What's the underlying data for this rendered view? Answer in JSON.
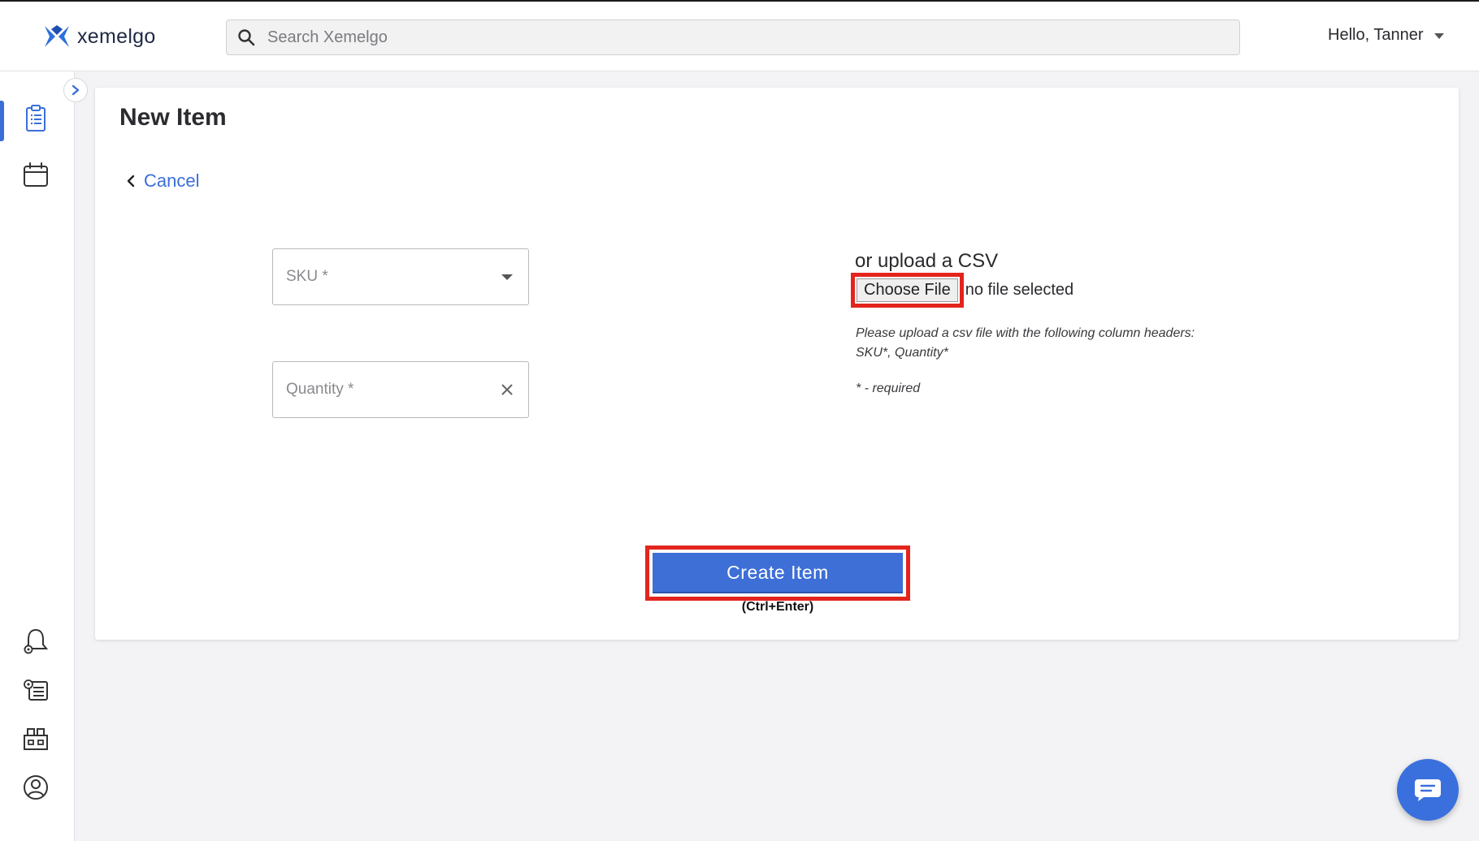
{
  "app": {
    "logo_text": "xemelgo"
  },
  "header": {
    "search": {
      "placeholder": "Search Xemelgo",
      "value": ""
    },
    "user_greeting": "Hello, Tanner"
  },
  "sidebar": {
    "items": [
      {
        "icon": "clipboard-list-icon",
        "active": true
      },
      {
        "icon": "calendar-icon",
        "active": false
      },
      {
        "icon": "bell-gear-icon",
        "active": false
      },
      {
        "icon": "list-gear-icon",
        "active": false
      },
      {
        "icon": "factory-icon",
        "active": false
      },
      {
        "icon": "user-circle-icon",
        "active": false
      }
    ]
  },
  "main": {
    "title": "New Item",
    "cancel_label": "Cancel",
    "form": {
      "sku_label": "SKU *",
      "quantity_label": "Quantity *"
    },
    "csv": {
      "title": "or upload a CSV",
      "choose_file_label": "Choose File",
      "file_status": "no file selected",
      "hint_line1": "Please upload a csv file with the following column headers:",
      "hint_line2": "SKU*, Quantity*",
      "required_note": "* - required"
    },
    "submit": {
      "label": "Create Item",
      "shortcut": "(Ctrl+Enter)"
    }
  },
  "colors": {
    "accent": "#3a6fd8",
    "button": "#3d6fd6",
    "highlight": "#e3251d"
  }
}
